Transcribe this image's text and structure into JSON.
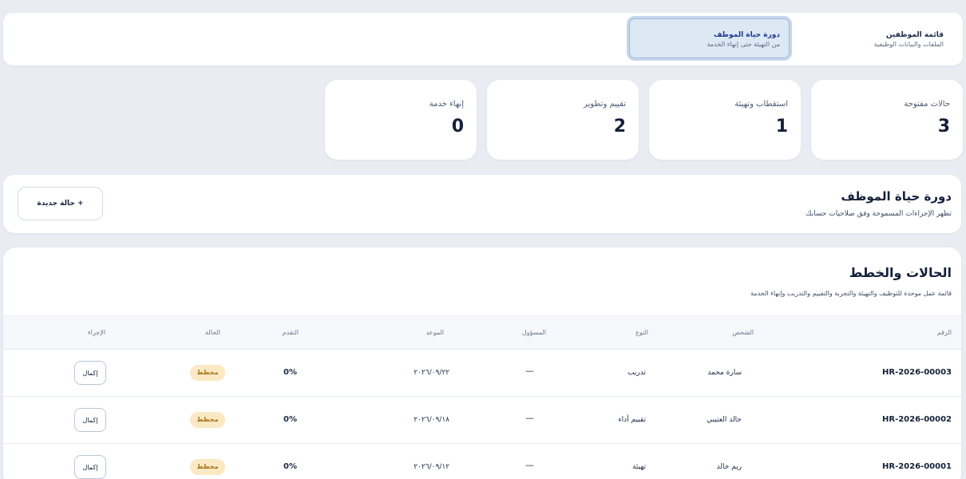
{
  "tabs": [
    {
      "title": "قائمة الموظفين",
      "subtitle": "الملفات والبيانات الوظيفية",
      "active": false
    },
    {
      "title": "دورة حياة الموظف",
      "subtitle": "من التهيئة حتى إنهاء الخدمة",
      "active": true
    }
  ],
  "stats": [
    {
      "label": "حالات مفتوحة",
      "value": "3"
    },
    {
      "label": "استقطاب وتهيئة",
      "value": "1"
    },
    {
      "label": "تقييم وتطوير",
      "value": "2"
    },
    {
      "label": "إنهاء خدمة",
      "value": "0"
    }
  ],
  "section": {
    "title": "دورة حياة الموظف",
    "subtitle": "تظهر الإجراءات المسموحة وفق صلاحيات حسابك",
    "new_button": "+ حالة جديدة"
  },
  "table": {
    "title": "الحالات والخطط",
    "subtitle": "قائمة عمل موحدة للتوظيف والتهيئة والتجربة والتقييم والتدريب وإنهاء الخدمة",
    "headers": {
      "id": "الرقم",
      "person": "الشخص",
      "type": "النوع",
      "owner": "المسؤول",
      "due": "الموعد",
      "progress": "التقدم",
      "status": "الحالة",
      "action": "الإجراء"
    },
    "rows": [
      {
        "id": "HR-2026-00003",
        "person": "سارة محمد",
        "type": "تدريب",
        "owner": "—",
        "due": "٢٠٢٦/٠٩/٢٢",
        "progress": "0%",
        "status": "مخطط",
        "action": "إكمال"
      },
      {
        "id": "HR-2026-00002",
        "person": "خالد العتيبي",
        "type": "تقييم أداء",
        "owner": "—",
        "due": "٢٠٢٦/٠٩/١٨",
        "progress": "0%",
        "status": "مخطط",
        "action": "إكمال"
      },
      {
        "id": "HR-2026-00001",
        "person": "ريم خالد",
        "type": "تهيئة",
        "owner": "—",
        "due": "٢٠٢٦/٠٩/١٢",
        "progress": "0%",
        "status": "مخطط",
        "action": "إكمال"
      }
    ]
  },
  "colors": {
    "accent": "#1e3a8a",
    "badge_bg": "#fbe9c4",
    "badge_text": "#a8711a",
    "background": "#e9edf3"
  }
}
